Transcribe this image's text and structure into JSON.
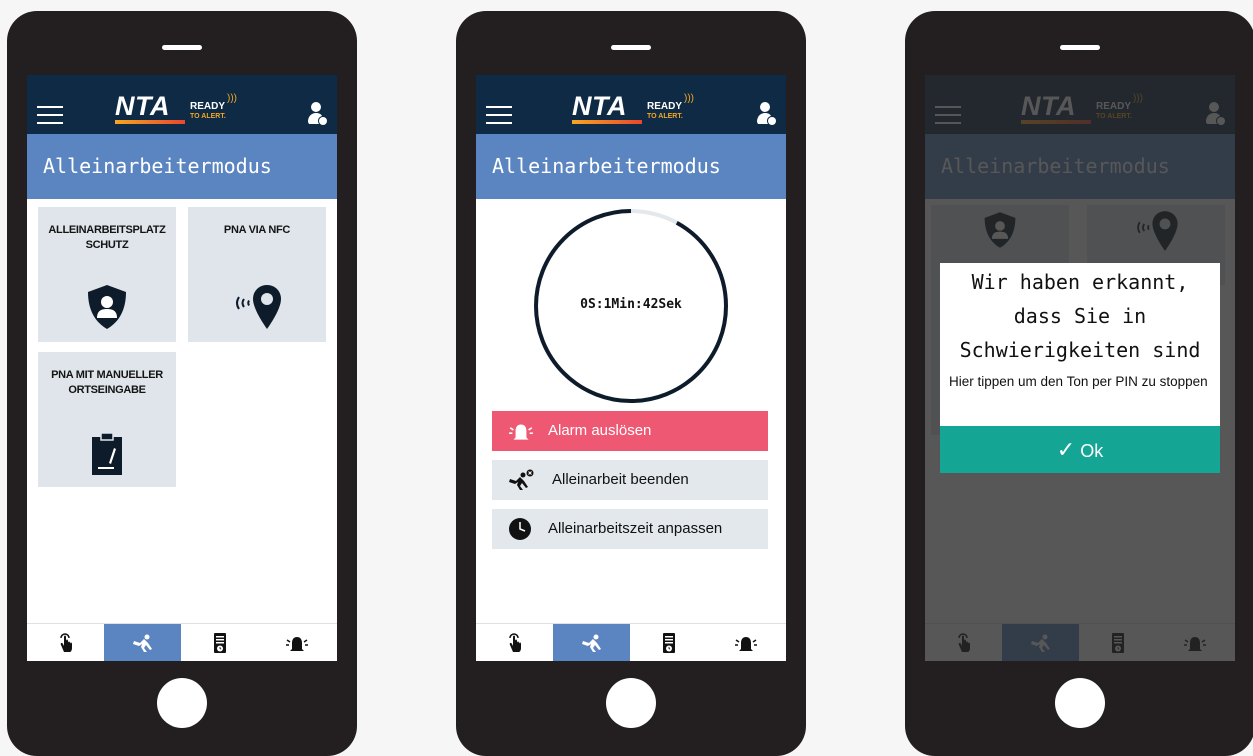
{
  "brand": {
    "name": "NTA",
    "ready": "READY",
    "tagline": "TO ALERT."
  },
  "page_title": "Alleinarbeitermodus",
  "tiles": [
    {
      "line1": "ALLEINARBEITSPLATZ",
      "line2": "SCHUTZ",
      "icon": "shield-person-icon"
    },
    {
      "line1": "PNA VIA NFC",
      "line2": "",
      "icon": "nfc-location-pin-icon"
    },
    {
      "line1": "PNA MIT MANUELLER",
      "line2": "ORTSEINGABE",
      "icon": "clipboard-edit-icon"
    }
  ],
  "timer": {
    "text": "0S:1Min:42Sek",
    "progress_remaining": 0.92
  },
  "actions": [
    {
      "label": "Alarm auslösen",
      "icon": "alarm-bell-icon",
      "color": "#ee5873"
    },
    {
      "label": "Alleinarbeit beenden",
      "icon": "lone-worker-end-icon"
    },
    {
      "label": "Alleinarbeitszeit anpassen",
      "icon": "clock-icon"
    }
  ],
  "dialog": {
    "title_line1": "Wir haben erkannt,",
    "title_line2": "dass Sie in",
    "title_line3": "Schwierigkeiten sind",
    "message": "Hier tippen um den Ton per PIN zu stoppen",
    "ok_label": "Ok"
  },
  "tabs": [
    "touch-icon",
    "lone-worker-icon",
    "device-clock-icon",
    "alarm-bell-icon"
  ],
  "colors": {
    "header": "#0e2a45",
    "title_bar": "#5b85c1",
    "alarm": "#ee5873",
    "ok": "#15a595",
    "tile": "#dfe5ea"
  }
}
